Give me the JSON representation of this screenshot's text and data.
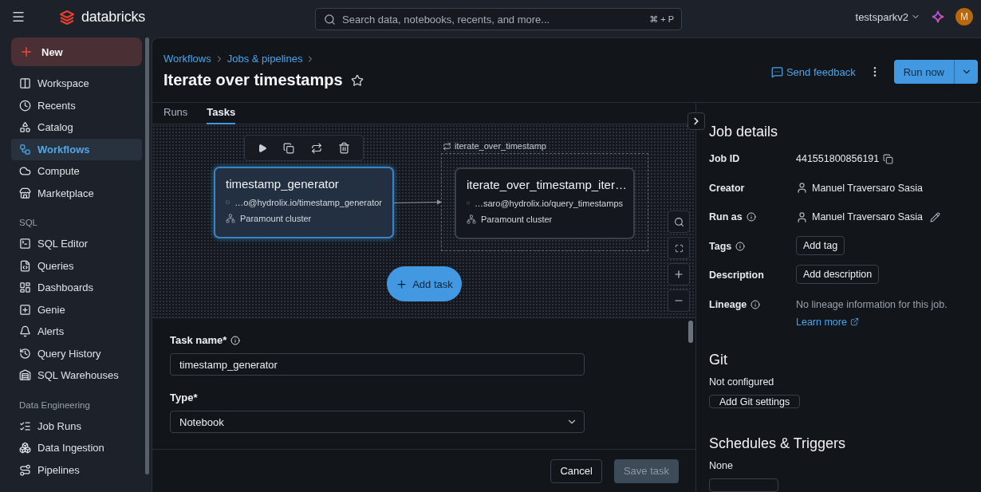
{
  "topbar": {
    "brand": "databricks",
    "search": {
      "placeholder": "Search data, notebooks, recents, and more...",
      "shortcut": "⌘ + P"
    },
    "workspace": "testsparkv2",
    "avatar": "M"
  },
  "sidebar": {
    "new_button": "New",
    "sections": [
      {
        "items": [
          {
            "label": "Workspace",
            "selected": false
          },
          {
            "label": "Recents",
            "selected": false
          },
          {
            "label": "Catalog",
            "selected": false
          },
          {
            "label": "Workflows",
            "selected": true
          },
          {
            "label": "Compute",
            "selected": false
          },
          {
            "label": "Marketplace",
            "selected": false
          }
        ]
      },
      {
        "heading": "SQL",
        "items": [
          {
            "label": "SQL Editor",
            "selected": false
          },
          {
            "label": "Queries",
            "selected": false
          },
          {
            "label": "Dashboards",
            "selected": false
          },
          {
            "label": "Genie",
            "selected": false
          },
          {
            "label": "Alerts",
            "selected": false
          },
          {
            "label": "Query History",
            "selected": false
          },
          {
            "label": "SQL Warehouses",
            "selected": false
          }
        ]
      },
      {
        "heading": "Data Engineering",
        "items": [
          {
            "label": "Job Runs",
            "selected": false
          },
          {
            "label": "Data Ingestion",
            "selected": false
          },
          {
            "label": "Pipelines",
            "selected": false
          }
        ]
      }
    ]
  },
  "header": {
    "breadcrumbs": [
      "Workflows",
      "Jobs & pipelines"
    ],
    "title": "Iterate over timestamps",
    "starred": false,
    "feedback": "Send feedback",
    "run_button": "Run now"
  },
  "tabs": [
    {
      "label": "Runs",
      "selected": false
    },
    {
      "label": "Tasks",
      "selected": true
    }
  ],
  "canvas": {
    "loop_label": "iterate_over_timestamp",
    "add_task": "Add task",
    "nodes": [
      {
        "title": "timestamp_generator",
        "path": "…o@hydrolix.io/timestamp_generator",
        "cluster": "Paramount cluster",
        "selected": true
      },
      {
        "title": "iterate_over_timestamp_iter…",
        "path": "…saro@hydrolix.io/query_timestamps",
        "cluster": "Paramount cluster",
        "selected": false
      }
    ]
  },
  "form": {
    "fields": [
      {
        "kind": "input",
        "label": "Task name*",
        "info": true,
        "value": "timestamp_generator"
      },
      {
        "kind": "select",
        "label": "Type*",
        "info": false,
        "value": "Notebook"
      }
    ],
    "cancel": "Cancel",
    "save": {
      "label": "Save task",
      "disabled": true
    }
  },
  "details": {
    "title": "Job details",
    "rows": [
      {
        "kind": "id",
        "label": "Job ID",
        "info": false,
        "value": "441551800856191"
      },
      {
        "kind": "user",
        "label": "Creator",
        "info": false,
        "value": "Manuel Traversaro Sasia",
        "editable": false
      },
      {
        "kind": "user",
        "label": "Run as",
        "info": true,
        "value": "Manuel Traversaro Sasia",
        "editable": true
      },
      {
        "kind": "button",
        "label": "Tags",
        "info": true,
        "value": "Add tag"
      },
      {
        "kind": "button",
        "label": "Description",
        "info": false,
        "value": "Add description"
      },
      {
        "kind": "note",
        "label": "Lineage",
        "info": true,
        "value": "No lineage information for this job.",
        "link": "Learn more"
      }
    ],
    "git": {
      "title": "Git",
      "status": "Not configured",
      "button": "Add Git settings"
    },
    "schedules": {
      "title": "Schedules & Triggers",
      "status": "None"
    }
  }
}
